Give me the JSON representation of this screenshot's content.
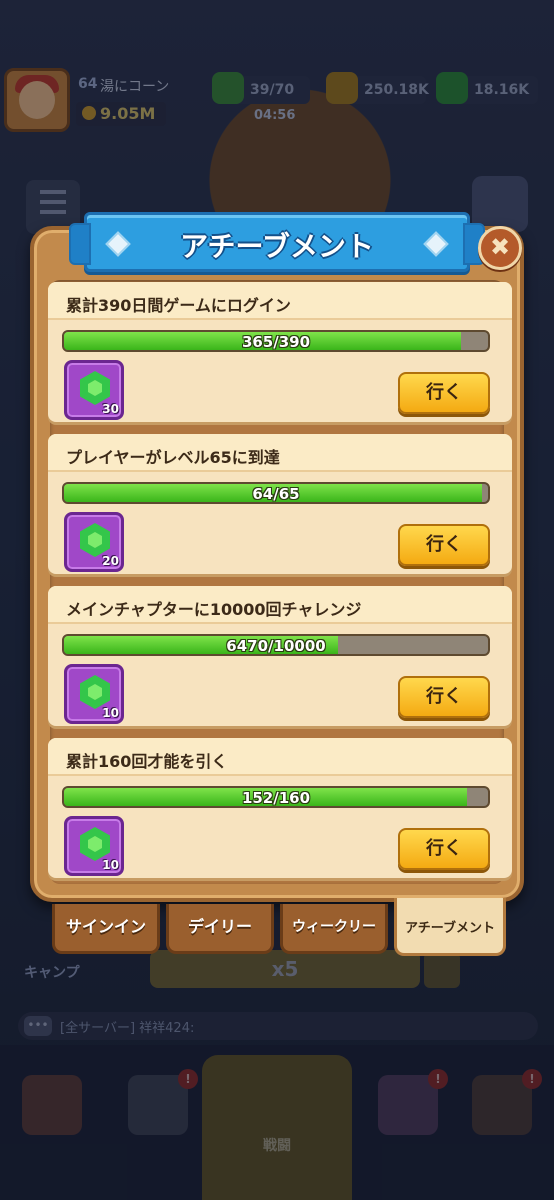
{
  "hud": {
    "level": "64",
    "player_name": "湯にコーン",
    "power": "9.05M",
    "stamina": "39/70",
    "gold": "250.18K",
    "gems": "18.16K",
    "timer": "04:56"
  },
  "background": {
    "camp_label": "キャンプ",
    "multiplier": "x5",
    "chat_text": "[全サーバー] 祥祥424:",
    "chat_icon": "chat-bubble-icon",
    "nav": {
      "battle_label": "戦闘",
      "badge": "!"
    }
  },
  "dialog": {
    "title": "アチーブメント",
    "close_glyph": "✖",
    "achievements": [
      {
        "title": "累計390日間ゲームにログイン",
        "progress_text": "365/390",
        "progress": 0.936,
        "reward_icon": "green-gem-icon",
        "reward_count": "30",
        "button_label": "行く"
      },
      {
        "title": "プレイヤーがレベル65に到達",
        "progress_text": "64/65",
        "progress": 0.985,
        "reward_icon": "green-gem-icon",
        "reward_count": "20",
        "button_label": "行く"
      },
      {
        "title": "メインチャプターに10000回チャレンジ",
        "progress_text": "6470/10000",
        "progress": 0.647,
        "reward_icon": "green-gem-icon",
        "reward_count": "10",
        "button_label": "行く"
      },
      {
        "title": "累計160回才能を引く",
        "progress_text": "152/160",
        "progress": 0.95,
        "reward_icon": "green-gem-icon",
        "reward_count": "10",
        "button_label": "行く"
      }
    ],
    "tabs": [
      {
        "label": "サインイン",
        "active": false
      },
      {
        "label": "デイリー",
        "active": false
      },
      {
        "label": "ウィークリー",
        "active": false
      },
      {
        "label": "アチーブメント",
        "active": true
      }
    ]
  },
  "colors": {
    "progress_fill": "#3ab51a",
    "title_banner": "#2d9ee0",
    "go_button": "#f4aa12",
    "reward_frame": "#a048c8"
  }
}
